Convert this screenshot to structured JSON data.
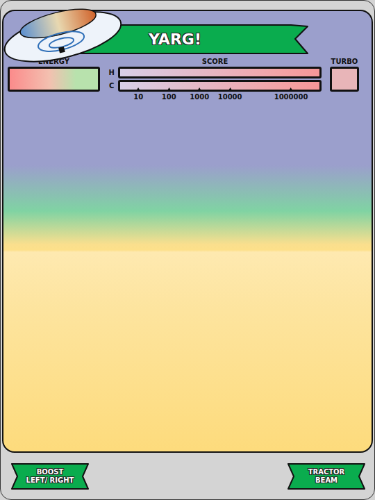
{
  "title": "YARG!",
  "energy": {
    "label": "ENERGY",
    "level": 1
  },
  "score": {
    "label": "SCORE",
    "rows": [
      {
        "label": "H",
        "level": 1
      },
      {
        "label": "C",
        "level": 1
      }
    ],
    "ticks": [
      "10",
      "100",
      "1000",
      "10000",
      "1000000"
    ]
  },
  "turbo": {
    "label": "TURBO",
    "level": 1
  },
  "buttons": [
    {
      "lines": [
        "BOOST",
        "LEFT/ RIGHT"
      ]
    },
    {
      "lines": [
        "TRACTOR",
        "BEAM"
      ]
    }
  ]
}
